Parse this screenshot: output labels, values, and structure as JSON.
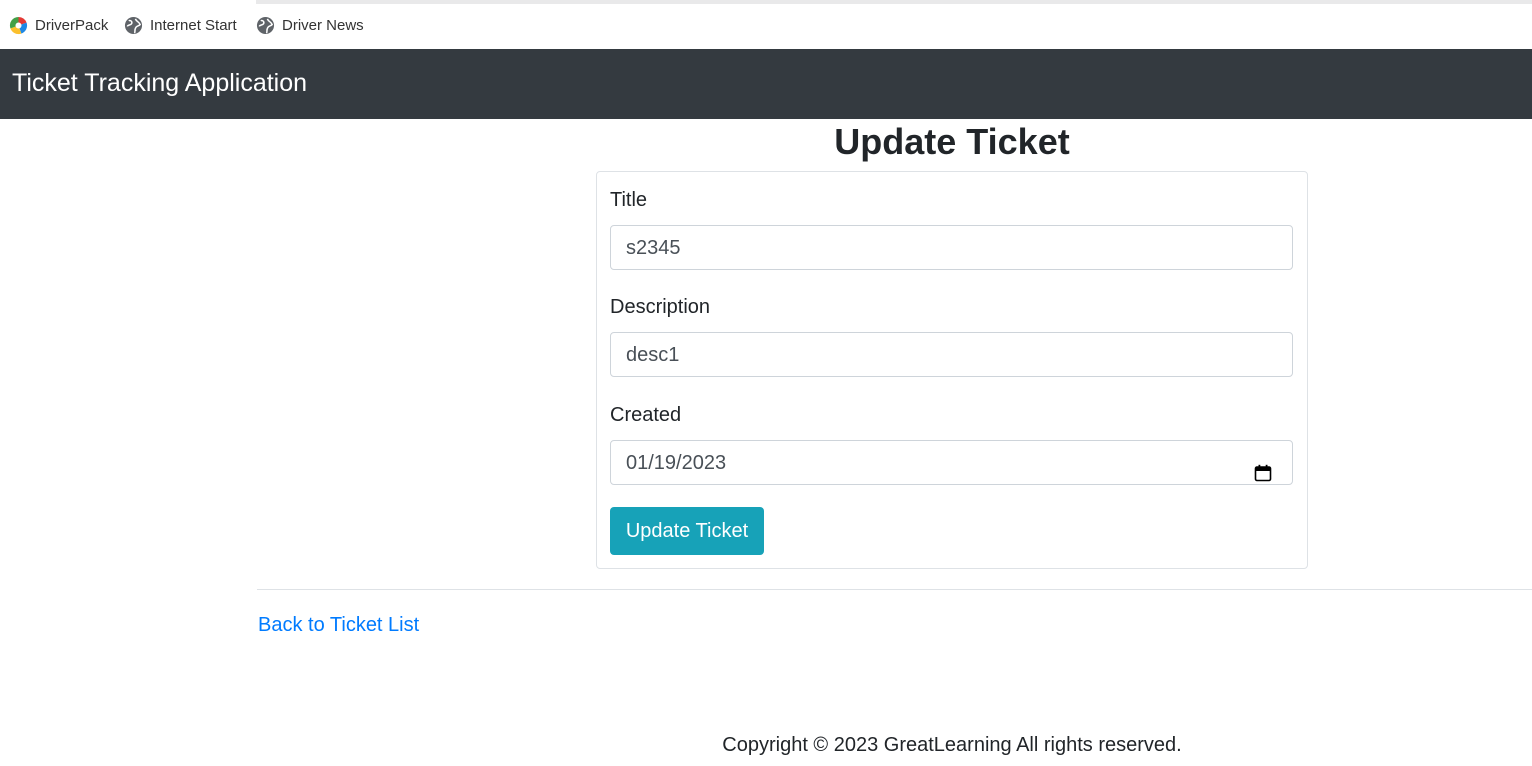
{
  "bookmarks": [
    {
      "label": "DriverPack",
      "icon": "driverpack-logo-icon"
    },
    {
      "label": "Internet Start",
      "icon": "globe-icon"
    },
    {
      "label": "Driver News",
      "icon": "globe-icon"
    }
  ],
  "navbar": {
    "brand": "Ticket Tracking Application",
    "background": "#343a40"
  },
  "page": {
    "title": "Update Ticket"
  },
  "form": {
    "title_label": "Title",
    "title_value": "s2345",
    "description_label": "Description",
    "description_value": "desc1",
    "created_label": "Created",
    "created_value": "01/19/2023",
    "submit_label": "Update Ticket",
    "submit_color": "#17a2b8"
  },
  "links": {
    "back": "Back to Ticket List",
    "link_color": "#007bff"
  },
  "footer": {
    "copyright": "Copyright © 2023 GreatLearning All rights reserved."
  }
}
